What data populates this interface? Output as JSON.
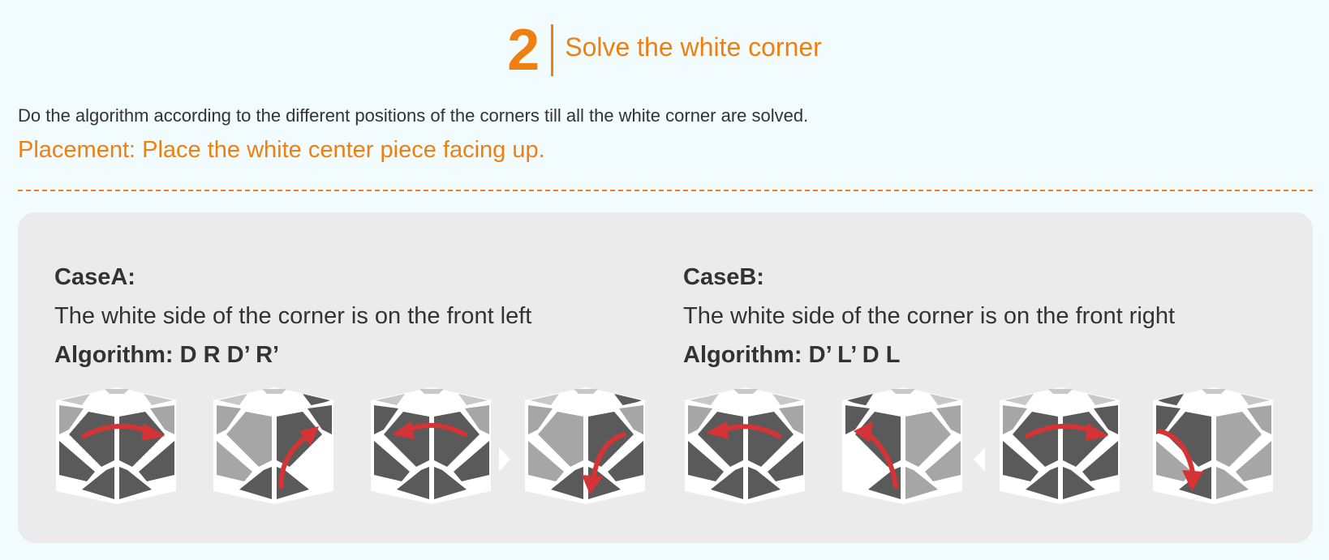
{
  "step": {
    "number": "2",
    "title": "Solve the white corner"
  },
  "intro_text": "Do the algorithm according to the different positions of the corners till all the white corner are solved.",
  "placement_text": "Placement: Place the white center piece facing up.",
  "colors": {
    "accent": "#ee8012",
    "arrow": "#d63336",
    "dark_piece": "#5a5a5a",
    "light_piece": "#a6a6a6",
    "top_piece": "#c8c8c8",
    "panel": "#ebebeb",
    "background": "#f2fbfd"
  },
  "cases": [
    {
      "title": "CaseA:",
      "description": "The white side of the corner is on the front left",
      "algorithm": "Algorithm: D R D’ R’",
      "images": [
        "skewb-move-d-icon",
        "skewb-move-r-icon",
        "skewb-move-d-prime-icon",
        "skewb-move-r-prime-icon"
      ]
    },
    {
      "title": "CaseB:",
      "description": "The white side of the corner is on the front right",
      "algorithm": "Algorithm: D’ L’ D L",
      "images": [
        "skewb-move-d-prime-icon",
        "skewb-move-l-prime-icon",
        "skewb-move-d-icon",
        "skewb-move-l-icon"
      ]
    }
  ]
}
